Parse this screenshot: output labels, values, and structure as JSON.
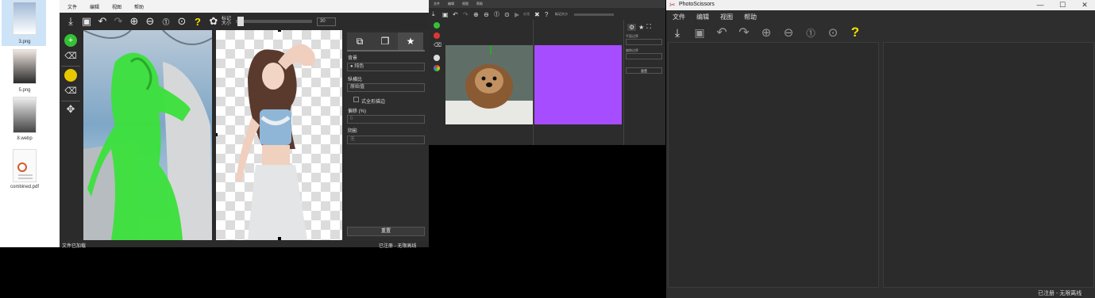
{
  "desktop": {
    "files": [
      {
        "name": "3.png"
      },
      {
        "name": "5.png"
      },
      {
        "name": "8.webp"
      },
      {
        "name": "combined.pdf"
      }
    ]
  },
  "app1": {
    "menu": [
      "文件",
      "编辑",
      "视图",
      "帮助"
    ],
    "toolbar": {
      "brush_size_label": "标记大小",
      "brush_size_value": "30"
    },
    "side_panel": {
      "background_label": "背景",
      "background_value": "纯色",
      "fill_label": "纵横比",
      "fill_value": "原始值",
      "shadow_checkbox_label": "式全形描边",
      "offset_label": "偏移 (%)",
      "offset_value": "0",
      "edge_label": "阴影",
      "edge_value": "无",
      "apply_button": "重置"
    },
    "status": {
      "left": "文件已加载",
      "right": "已注册 - 无限高线"
    }
  },
  "app2": {
    "menu": [
      "文件",
      "编辑",
      "视图",
      "帮助"
    ],
    "toolbar": {
      "run_label": "处理",
      "brush_label": "标记大小"
    },
    "side": {
      "label1": "平面边界",
      "label2": "偏移边界",
      "button": "重置"
    },
    "colors": {
      "purple": "#a64dff"
    }
  },
  "app3": {
    "title": "PhotoScissors",
    "menu": [
      "文件",
      "编辑",
      "视图",
      "帮助"
    ],
    "status": "已注册 - 无限离线"
  }
}
